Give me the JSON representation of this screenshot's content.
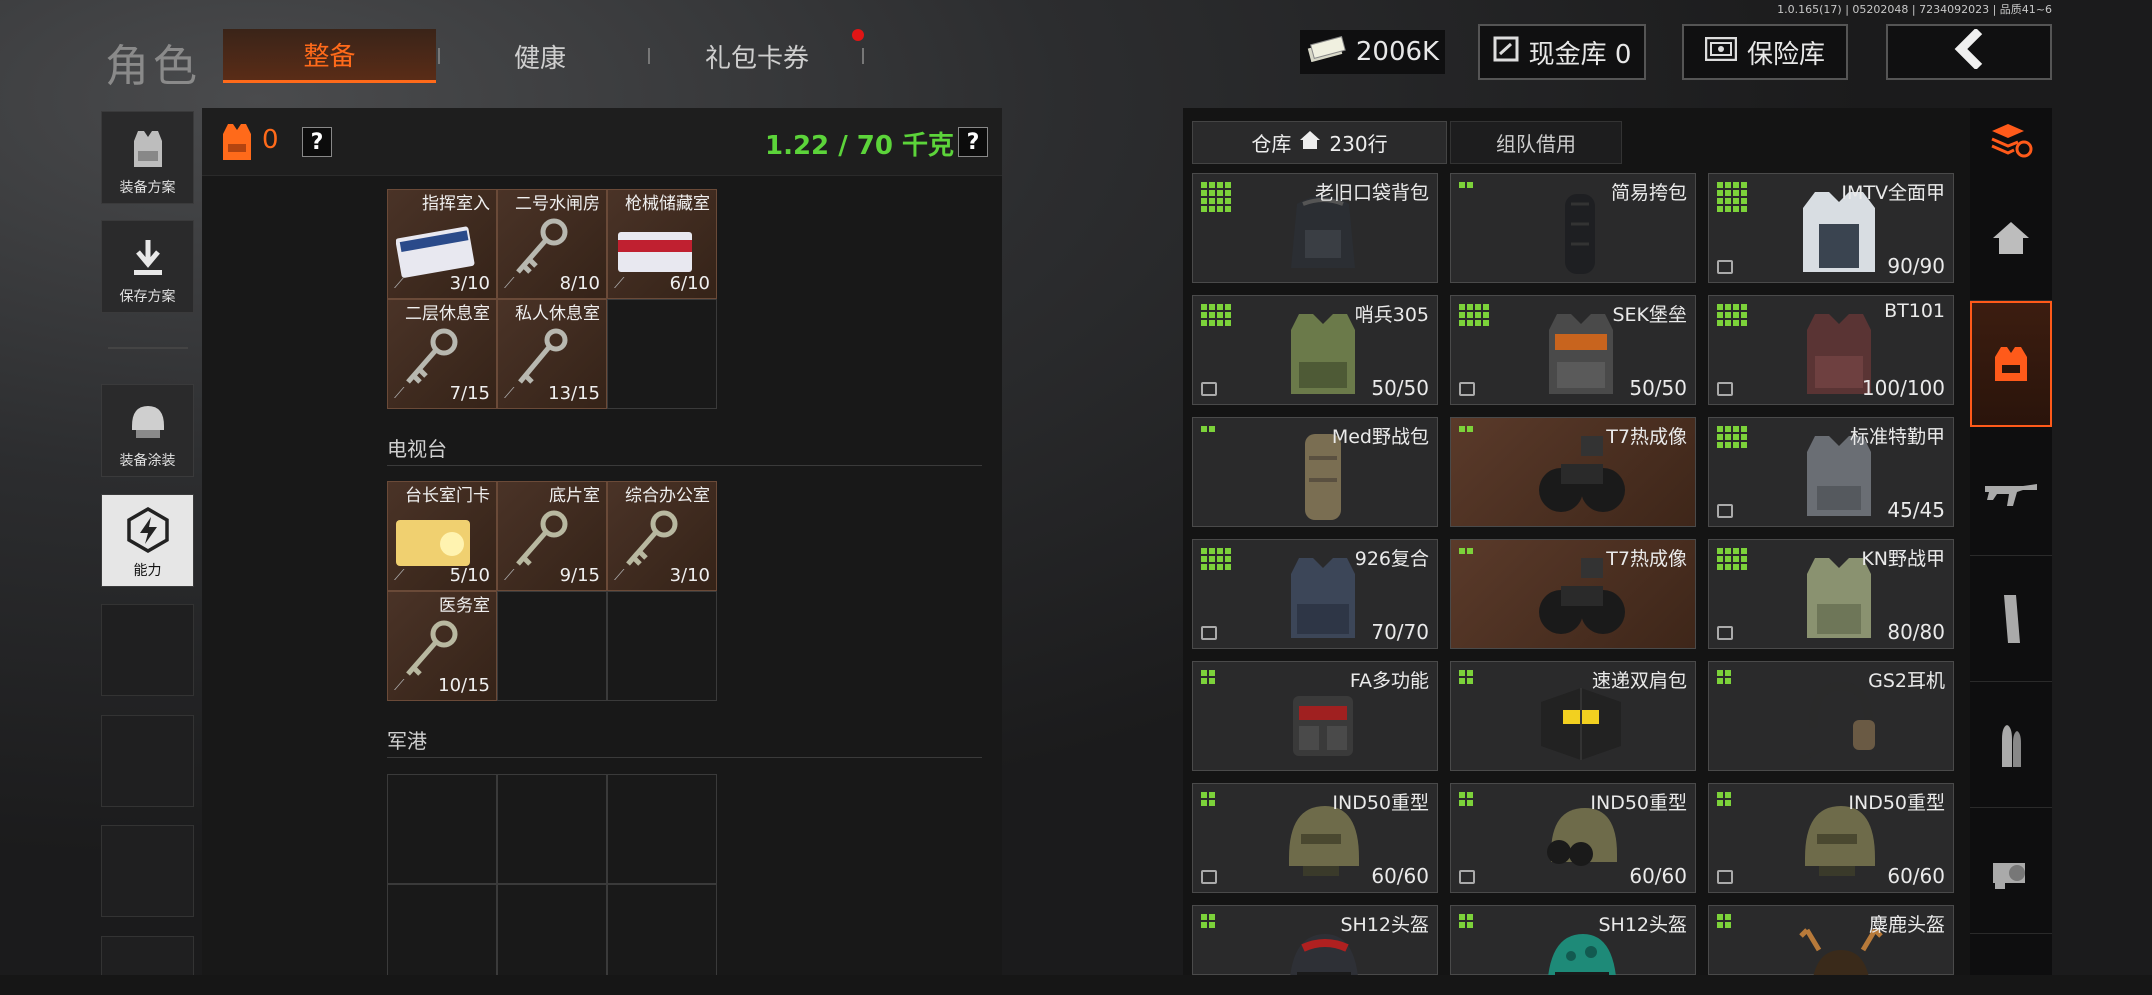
{
  "version": "1.0.165(17) | 05202048 | 7234092023 | 品质41~6",
  "title": "角色",
  "tabs": [
    {
      "label": "整备"
    },
    {
      "label": "健康"
    },
    {
      "label": "礼包卡券"
    }
  ],
  "topbar": {
    "money": "2006K",
    "vault": "现金库 0",
    "insurance": "保险库"
  },
  "sidebar": [
    {
      "label": "装备方案",
      "icon": "vest-plan-icon"
    },
    {
      "label": "保存方案",
      "icon": "download-icon"
    },
    {
      "label": "装备涂装",
      "icon": "helmet-paint-icon"
    },
    {
      "label": "能力",
      "icon": "ability-icon"
    }
  ],
  "mid": {
    "armor_count": "0",
    "help": "?",
    "weight": "1.22 / 70 千克",
    "sections": [
      {
        "title": "",
        "keys": [
          {
            "name": "指挥室入",
            "count": "3/10"
          },
          {
            "name": "二号水闸房",
            "count": "8/10"
          },
          {
            "name": "枪械储藏室",
            "count": "6/10"
          },
          {
            "name": "二层休息室",
            "count": "7/15"
          },
          {
            "name": "私人休息室",
            "count": "13/15"
          }
        ]
      },
      {
        "title": "电视台",
        "keys": [
          {
            "name": "台长室门卡",
            "count": "5/10"
          },
          {
            "name": "底片室",
            "count": "9/15"
          },
          {
            "name": "综合办公室",
            "count": "3/10"
          },
          {
            "name": "医务室",
            "count": "10/15"
          }
        ]
      },
      {
        "title": "军港",
        "keys": []
      }
    ]
  },
  "warehouse": {
    "tab1": "仓库",
    "tab1_rows": "230行",
    "tab2": "组队借用",
    "items": [
      {
        "name": "老旧口袋背包",
        "count": "",
        "size": 16,
        "art": "backpack",
        "highlight": false
      },
      {
        "name": "简易挎包",
        "count": "",
        "size": 2,
        "art": "sling",
        "highlight": false
      },
      {
        "name": "IMTV全面甲",
        "count": "90/90",
        "size": 16,
        "art": "armor-white",
        "highlight": false
      },
      {
        "name": "哨兵305",
        "count": "50/50",
        "size": 12,
        "art": "vest-camo",
        "highlight": false
      },
      {
        "name": "SEK堡垒",
        "count": "50/50",
        "size": 12,
        "art": "vest-orange",
        "highlight": false
      },
      {
        "name": "BT101",
        "count": "100/100",
        "size": 12,
        "art": "vest-red",
        "highlight": false
      },
      {
        "name": "Med野战包",
        "count": "",
        "size": 2,
        "art": "medbag",
        "highlight": false
      },
      {
        "name": "T7热成像",
        "count": "",
        "size": 2,
        "art": "nvg",
        "highlight": true
      },
      {
        "name": "标准特勤甲",
        "count": "45/45",
        "size": 12,
        "art": "vest-grey",
        "highlight": false
      },
      {
        "name": "926复合",
        "count": "70/70",
        "size": 12,
        "art": "vest-blue",
        "highlight": false
      },
      {
        "name": "T7热成像",
        "count": "",
        "size": 2,
        "art": "nvg",
        "highlight": true
      },
      {
        "name": "KN野战甲",
        "count": "80/80",
        "size": 12,
        "art": "vest-green",
        "highlight": false
      },
      {
        "name": "FA多功能",
        "count": "",
        "size": 4,
        "art": "chest-rig",
        "highlight": false
      },
      {
        "name": "速递双肩包",
        "count": "",
        "size": 4,
        "art": "delivery",
        "highlight": false
      },
      {
        "name": "GS2耳机",
        "count": "",
        "size": 4,
        "art": "headset",
        "highlight": false
      },
      {
        "name": "IND50重型",
        "count": "60/60",
        "size": 4,
        "art": "helmet",
        "highlight": false
      },
      {
        "name": "IND50重型",
        "count": "60/60",
        "size": 4,
        "art": "helmet-nvg",
        "highlight": false
      },
      {
        "name": "IND50重型",
        "count": "60/60",
        "size": 4,
        "art": "helmet",
        "highlight": false
      },
      {
        "name": "SH12头盔",
        "count": "",
        "size": 4,
        "art": "helmet-red",
        "highlight": false
      },
      {
        "name": "SH12头盔",
        "count": "",
        "size": 4,
        "art": "helmet-teal",
        "highlight": false
      },
      {
        "name": "麋鹿头盔",
        "count": "",
        "size": 4,
        "art": "helmet-elk",
        "highlight": false
      }
    ]
  },
  "categories": [
    "stack-refresh-icon",
    "home-icon",
    "armor-category-icon",
    "rifle-icon",
    "magazine-icon",
    "ammo-icon",
    "scope-icon"
  ],
  "colors": {
    "accent": "#ff6a1a",
    "weight": "#5cd43a",
    "size_pip": "#7cd23a"
  }
}
